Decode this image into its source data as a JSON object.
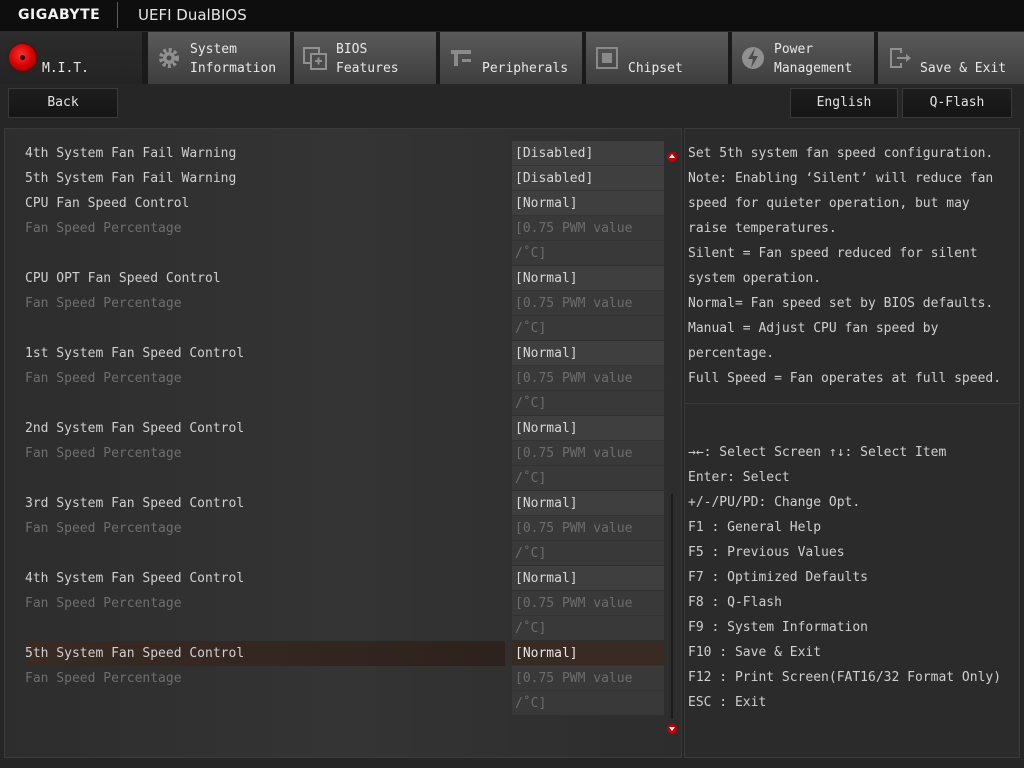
{
  "header": {
    "brand": "GIGABYTE",
    "product": "UEFI DualBIOS"
  },
  "tabs": [
    {
      "id": "mit",
      "lines": [
        "M.I.T."
      ],
      "icon": "mit-red-dot-icon",
      "active": true
    },
    {
      "id": "system",
      "lines": [
        "System",
        "Information"
      ],
      "icon": "gear-icon",
      "active": false
    },
    {
      "id": "bios",
      "lines": [
        "BIOS",
        "Features"
      ],
      "icon": "bios-chip-icon",
      "active": false
    },
    {
      "id": "peripherals",
      "lines": [
        "Peripherals"
      ],
      "icon": "peripherals-icon",
      "active": false
    },
    {
      "id": "chipset",
      "lines": [
        "Chipset"
      ],
      "icon": "chipset-icon",
      "active": false
    },
    {
      "id": "power",
      "lines": [
        "Power",
        "Management"
      ],
      "icon": "power-icon",
      "active": false
    },
    {
      "id": "save",
      "lines": [
        "Save & Exit"
      ],
      "icon": "exit-door-icon",
      "active": false
    }
  ],
  "buttons": {
    "back": "Back",
    "language": "English",
    "qflash": "Q-Flash"
  },
  "settings": [
    {
      "label": "4th System Fan Fail Warning",
      "value": "[Disabled]",
      "dim": false
    },
    {
      "label": "5th System Fan Fail Warning",
      "value": "[Disabled]",
      "dim": false
    },
    {
      "label": "CPU Fan Speed Control",
      "value": "[Normal]",
      "dim": false
    },
    {
      "label": "Fan Speed Percentage",
      "value": "[0.75 PWM value",
      "value2": "/˚C]",
      "dim": true
    },
    {
      "label": "CPU OPT Fan Speed Control",
      "value": "[Normal]",
      "dim": false
    },
    {
      "label": "Fan Speed Percentage",
      "value": "[0.75 PWM value",
      "value2": "/˚C]",
      "dim": true
    },
    {
      "label": "1st System Fan Speed Control",
      "value": "[Normal]",
      "dim": false
    },
    {
      "label": "Fan Speed Percentage",
      "value": "[0.75 PWM value",
      "value2": "/˚C]",
      "dim": true
    },
    {
      "label": "2nd System Fan Speed Control",
      "value": "[Normal]",
      "dim": false
    },
    {
      "label": "Fan Speed Percentage",
      "value": "[0.75 PWM value",
      "value2": "/˚C]",
      "dim": true
    },
    {
      "label": "3rd System Fan Speed Control",
      "value": "[Normal]",
      "dim": false
    },
    {
      "label": "Fan Speed Percentage",
      "value": "[0.75 PWM value",
      "value2": "/˚C]",
      "dim": true
    },
    {
      "label": "4th System Fan Speed Control",
      "value": "[Normal]",
      "dim": false
    },
    {
      "label": "Fan Speed Percentage",
      "value": "[0.75 PWM value",
      "value2": "/˚C]",
      "dim": true
    },
    {
      "label": "5th System Fan Speed Control",
      "value": "[Normal]",
      "dim": false,
      "selected": true
    },
    {
      "label": "Fan Speed Percentage",
      "value": "[0.75 PWM value",
      "value2": "/˚C]",
      "dim": true
    }
  ],
  "help_lines": [
    "Set 5th system fan speed configuration.",
    "Note: Enabling ‘Silent’ will reduce fan",
    "speed for quieter operation, but may",
    "raise temperatures.",
    "Silent = Fan speed reduced for silent",
    "system operation.",
    "Normal= Fan speed set by BIOS defaults.",
    "Manual = Adjust CPU fan speed by",
    "percentage.",
    "Full Speed = Fan operates at full speed."
  ],
  "key_lines": [
    "→←: Select Screen  ↑↓: Select Item",
    "Enter: Select",
    "+/-/PU/PD: Change Opt.",
    "F1  : General Help",
    "F5  : Previous Values",
    "F7  : Optimized Defaults",
    "F8  : Q-Flash",
    "F9  : System Information",
    "F10 : Save & Exit",
    "F12 : Print Screen(FAT16/32 Format Only)",
    "ESC : Exit"
  ]
}
